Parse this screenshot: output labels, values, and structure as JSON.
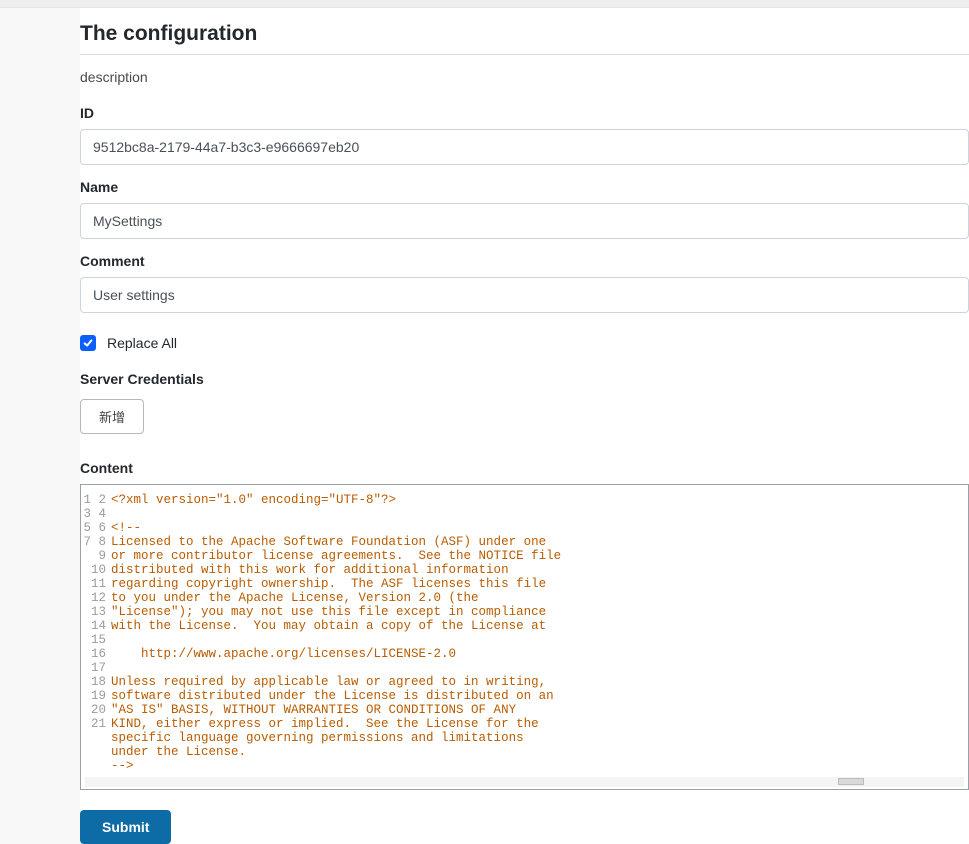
{
  "header": {
    "title": "The configuration"
  },
  "description": "description",
  "fields": {
    "id": {
      "label": "ID",
      "value": "9512bc8a-2179-44a7-b3c3-e9666697eb20"
    },
    "name": {
      "label": "Name",
      "value": "MySettings"
    },
    "comment": {
      "label": "Comment",
      "value": "User settings"
    }
  },
  "replaceAll": {
    "label": "Replace All",
    "checked": true
  },
  "serverCredentials": {
    "label": "Server Credentials",
    "add_button": "新增"
  },
  "content": {
    "label": "Content",
    "line_numbers": [
      "1",
      "2",
      "3",
      "4",
      "5",
      "6",
      "7",
      "8",
      "9",
      "10",
      "11",
      "12",
      "13",
      "14",
      "15",
      "16",
      "17",
      "18",
      "19",
      "20",
      "21"
    ],
    "lines": [
      "<?xml version=\"1.0\" encoding=\"UTF-8\"?>",
      "",
      "<!--",
      "Licensed to the Apache Software Foundation (ASF) under one",
      "or more contributor license agreements.  See the NOTICE file",
      "distributed with this work for additional information",
      "regarding copyright ownership.  The ASF licenses this file",
      "to you under the Apache License, Version 2.0 (the",
      "\"License\"); you may not use this file except in compliance",
      "with the License.  You may obtain a copy of the License at",
      "",
      "    http://www.apache.org/licenses/LICENSE-2.0",
      "",
      "Unless required by applicable law or agreed to in writing,",
      "software distributed under the License is distributed on an",
      "\"AS IS\" BASIS, WITHOUT WARRANTIES OR CONDITIONS OF ANY",
      "KIND, either express or implied.  See the License for the",
      "specific language governing permissions and limitations",
      "under the License.",
      "-->",
      ""
    ]
  },
  "actions": {
    "submit": "Submit"
  }
}
